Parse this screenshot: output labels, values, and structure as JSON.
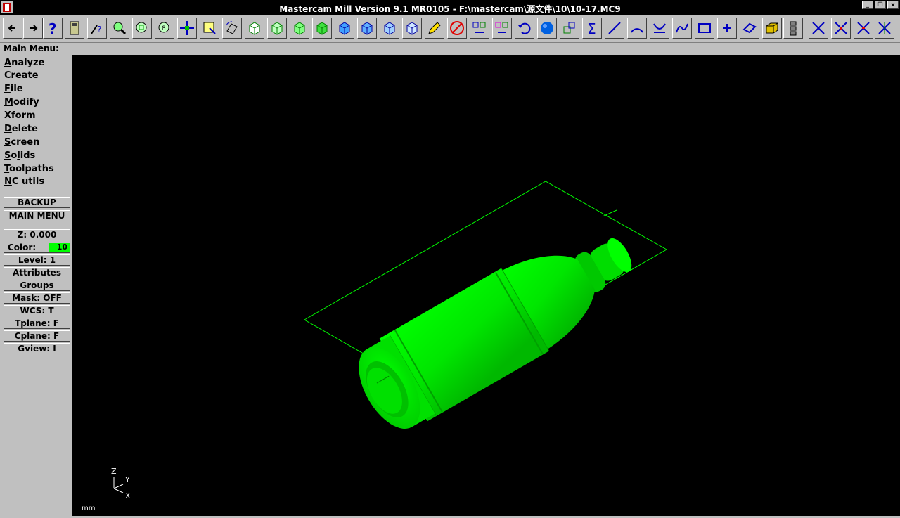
{
  "window": {
    "title": "Mastercam Mill Version 9.1 MR0105 - F:\\mastercam\\源文件\\10\\10-17.MC9",
    "minimize_label": "_",
    "restore_label": "❐",
    "close_label": "x"
  },
  "toolbar": {
    "buttons": [
      {
        "name": "back-arrow-icon"
      },
      {
        "name": "forward-arrow-icon"
      },
      {
        "name": "help-icon"
      },
      {
        "name": "calculator-icon"
      },
      {
        "name": "analyze-query-icon"
      },
      {
        "name": "zoom-in-icon"
      },
      {
        "name": "zoom-window-icon"
      },
      {
        "name": "zoom-scale-icon"
      },
      {
        "name": "pan-icon"
      },
      {
        "name": "select-edit-icon"
      },
      {
        "name": "rotate-view-icon"
      },
      {
        "name": "view-top-icon"
      },
      {
        "name": "view-front-icon"
      },
      {
        "name": "view-side-icon"
      },
      {
        "name": "view-iso-icon"
      },
      {
        "name": "cplane-top-icon"
      },
      {
        "name": "cplane-front-icon"
      },
      {
        "name": "cplane-side-icon"
      },
      {
        "name": "cplane-3d-icon"
      },
      {
        "name": "pencil-icon"
      },
      {
        "name": "no-delete-icon"
      },
      {
        "name": "translate-icon"
      },
      {
        "name": "copy-icon"
      },
      {
        "name": "undo-icon"
      },
      {
        "name": "sphere-icon"
      },
      {
        "name": "scale-icon"
      },
      {
        "name": "sum-icon"
      },
      {
        "name": "line-icon"
      },
      {
        "name": "arc-icon"
      },
      {
        "name": "fillet-icon"
      },
      {
        "name": "spline-icon"
      },
      {
        "name": "rectangle-icon"
      },
      {
        "name": "point-icon"
      },
      {
        "name": "surface-icon"
      },
      {
        "name": "solid-box-icon"
      },
      {
        "name": "tree-icon"
      },
      {
        "name": "trim-icon"
      },
      {
        "name": "break-icon"
      },
      {
        "name": "trim-divide-icon"
      },
      {
        "name": "trim-multi-icon"
      }
    ]
  },
  "main_menu": {
    "label": "Main Menu:",
    "items": [
      {
        "hot": "A",
        "rest": "nalyze"
      },
      {
        "hot": "C",
        "rest": "reate"
      },
      {
        "hot": "F",
        "rest": "ile"
      },
      {
        "hot": "M",
        "rest": "odify"
      },
      {
        "hot": "X",
        "rest": "form"
      },
      {
        "hot": "D",
        "rest": "elete"
      },
      {
        "hot": "S",
        "rest": "creen"
      },
      {
        "hot": "S",
        "rest": "o",
        "hot2": "l",
        "rest2": "ids"
      },
      {
        "hot": "T",
        "rest": "oolpaths"
      },
      {
        "hot": "N",
        "rest": "C utils"
      }
    ],
    "backup_label": "BACKUP",
    "mainmenu_label": "MAIN MENU"
  },
  "status": {
    "z": "Z:   0.000",
    "color_label": "Color:",
    "color_value": "10",
    "color_hex": "#00ff00",
    "level": "Level:   1",
    "attributes": "Attributes",
    "groups": "Groups",
    "mask": "Mask:  OFF",
    "wcs": "WCS:   T",
    "tplane": "Tplane:  F",
    "cplane": "Cplane:  F",
    "gview": "Gview:   I"
  },
  "viewport": {
    "background": "#000000",
    "geometry_color": "#00ff00",
    "axis_labels": {
      "z": "Z",
      "y": "Y",
      "x": "X"
    },
    "units": "mm"
  }
}
